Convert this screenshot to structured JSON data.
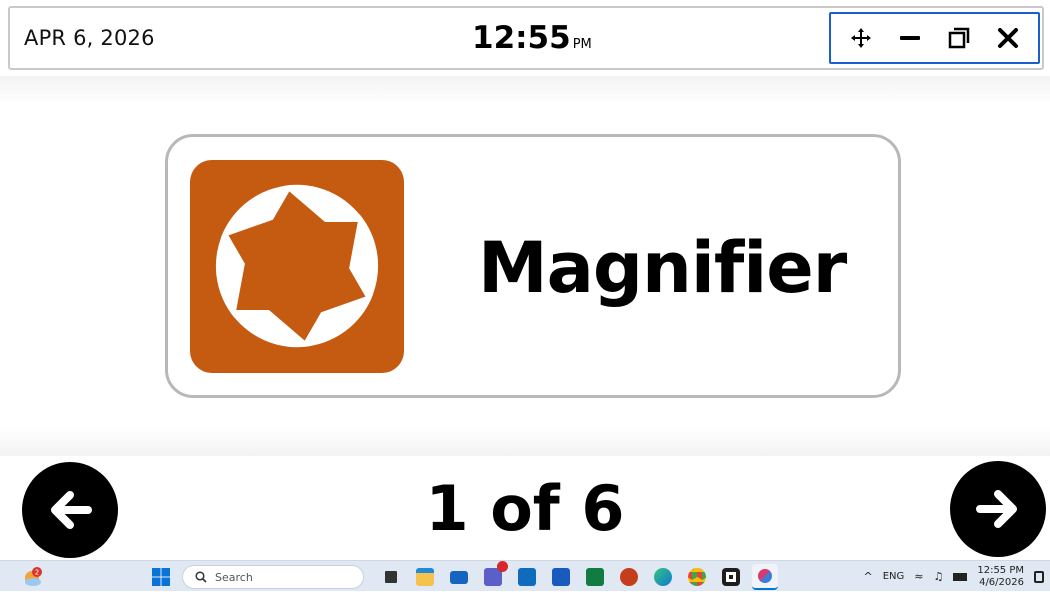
{
  "topbar": {
    "date": "APR 6, 2026",
    "time": "12:55",
    "ampm": "PM",
    "controls": [
      {
        "name": "move-icon"
      },
      {
        "name": "minimize-icon"
      },
      {
        "name": "restore-icon"
      },
      {
        "name": "close-icon"
      }
    ]
  },
  "card": {
    "app_name": "Magnifier",
    "icon": "magnifier-aperture-icon",
    "icon_color": "#c55a11"
  },
  "nav": {
    "counter": "1 of 6",
    "prev_icon": "arrow-left-icon",
    "next_icon": "arrow-right-icon"
  },
  "taskbar": {
    "weather_badge": "2",
    "search_placeholder": "Search",
    "apps": [
      "task-view",
      "file-explorer",
      "remote-desktop",
      "teams",
      "outlook",
      "word",
      "excel",
      "powerpoint",
      "edge",
      "chrome",
      "magnifier",
      "snipping-tool"
    ],
    "tray": {
      "lang": "ENG",
      "time": "12:55 PM",
      "date": "4/6/2026"
    },
    "accent": "#0078d4"
  }
}
